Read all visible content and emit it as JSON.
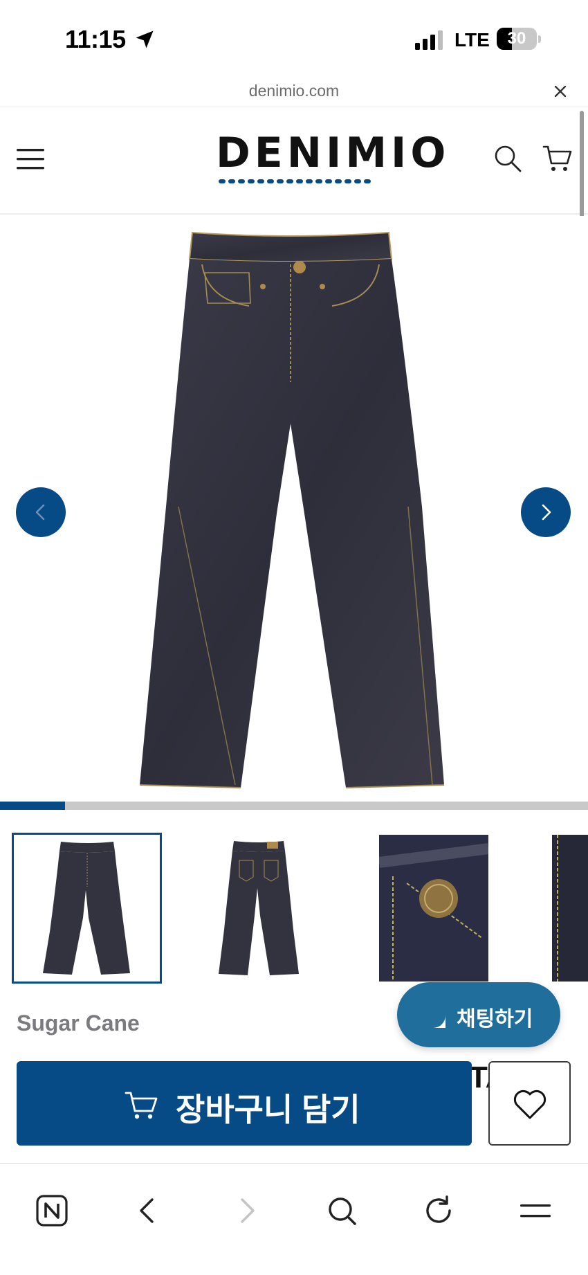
{
  "status_bar": {
    "time": "11:15",
    "network": "LTE",
    "battery": "30",
    "icons": [
      "location-arrow-icon",
      "signal-icon",
      "battery-icon"
    ]
  },
  "url_bar": {
    "domain": "denimio.com",
    "close_icon": "close-icon"
  },
  "header": {
    "logo_text": "DENIMIO",
    "menu_icon": "hamburger-menu-icon",
    "search_icon": "search-icon",
    "cart_icon": "cart-icon",
    "brand_color": "#064a86"
  },
  "gallery": {
    "prev_icon": "chevron-left-icon",
    "next_icon": "chevron-right-icon",
    "progress": 0.11,
    "thumbnails": [
      "jeans-front",
      "jeans-back",
      "button-closeup",
      "jeans-detail"
    ]
  },
  "product": {
    "brand": "Sugar Cane",
    "title_peek": "TA"
  },
  "chat": {
    "label": "채팅하기",
    "icon": "chat-bubble-icon",
    "color": "#1f6e9b"
  },
  "actions": {
    "add_to_cart_label": "장바구니 담기",
    "cart_icon": "cart-icon",
    "wishlist_icon": "heart-icon"
  },
  "browser_toolbar": {
    "icons": [
      "naver-n-icon",
      "back-icon",
      "forward-icon",
      "search-icon",
      "reload-icon",
      "menu-icon"
    ]
  }
}
